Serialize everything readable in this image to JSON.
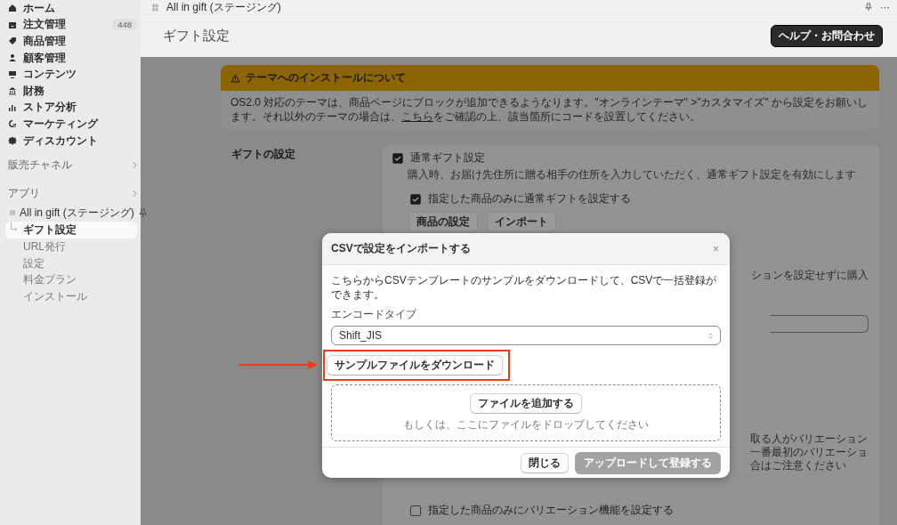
{
  "sidebar": {
    "nav": [
      {
        "label": "ホーム"
      },
      {
        "label": "注文管理",
        "badge": "448"
      },
      {
        "label": "商品管理"
      },
      {
        "label": "顧客管理"
      },
      {
        "label": "コンテンツ"
      },
      {
        "label": "財務"
      },
      {
        "label": "ストア分析"
      },
      {
        "label": "マーケティング"
      },
      {
        "label": "ディスカウント"
      }
    ],
    "sections": [
      {
        "label": "販売チャネル"
      },
      {
        "label": "アプリ"
      }
    ],
    "app": {
      "name": "All in gift (ステージング)",
      "items": [
        {
          "label": "ギフト設定",
          "selected": true
        },
        {
          "label": "URL発行",
          "selected": false
        },
        {
          "label": "設定",
          "selected": false
        },
        {
          "label": "料金プラン",
          "selected": false
        },
        {
          "label": "インストール",
          "selected": false
        }
      ]
    }
  },
  "topbar": {
    "app_name": "All in gift (ステージング)",
    "more": "···"
  },
  "header": {
    "title": "ギフト設定",
    "help_button": "ヘルプ・お問合わせ"
  },
  "banner": {
    "title": "テーマへのインストールについて",
    "body_before": "OS2.0 対応のテーマは、商品ページにブロックが追加できるようなります。\"オンラインテーマ\" >\"カスタマイズ\" から設定をお願いします。それ以外のテーマの場合は、",
    "link": "こちら",
    "body_after": "をご確認の上、該当箇所にコードを設置してください。"
  },
  "settings": {
    "section_title": "ギフトの設定",
    "gift_option": {
      "label": "通常ギフト設定",
      "checked": true,
      "description": "購入時、お届け先住所に贈る相手の住所を入力していただく、通常ギフト設定を有効にします"
    },
    "product_only": {
      "label": "指定した商品のみに通常ギフトを設定する",
      "checked": true
    },
    "buttons": [
      "商品の設定",
      "インポート"
    ],
    "partial_text": "ションを設定せずに購入",
    "partial_lines": [
      "取る人がバリエーション",
      "一番最初のバリエーショ",
      "合はご注意ください"
    ],
    "variation_only": {
      "label": "指定した商品のみにバリエーション機能を設定する",
      "checked": false
    }
  },
  "modal": {
    "title": "CSVで設定をインポートする",
    "close": "×",
    "intro": "こちらからCSVテンプレートのサンプルをダウンロードして、CSVで一括登録ができます。",
    "encode_label": "エンコードタイプ",
    "encode_value": "Shift_JIS",
    "sample_button": "サンプルファイルをダウンロード",
    "add_file_button": "ファイルを追加する",
    "drop_hint": "もしくは、ここにファイルをドロップしてください",
    "close_button": "閉じる",
    "upload_button": {
      "label": "アップロードして登録する",
      "disabled": true
    }
  }
}
